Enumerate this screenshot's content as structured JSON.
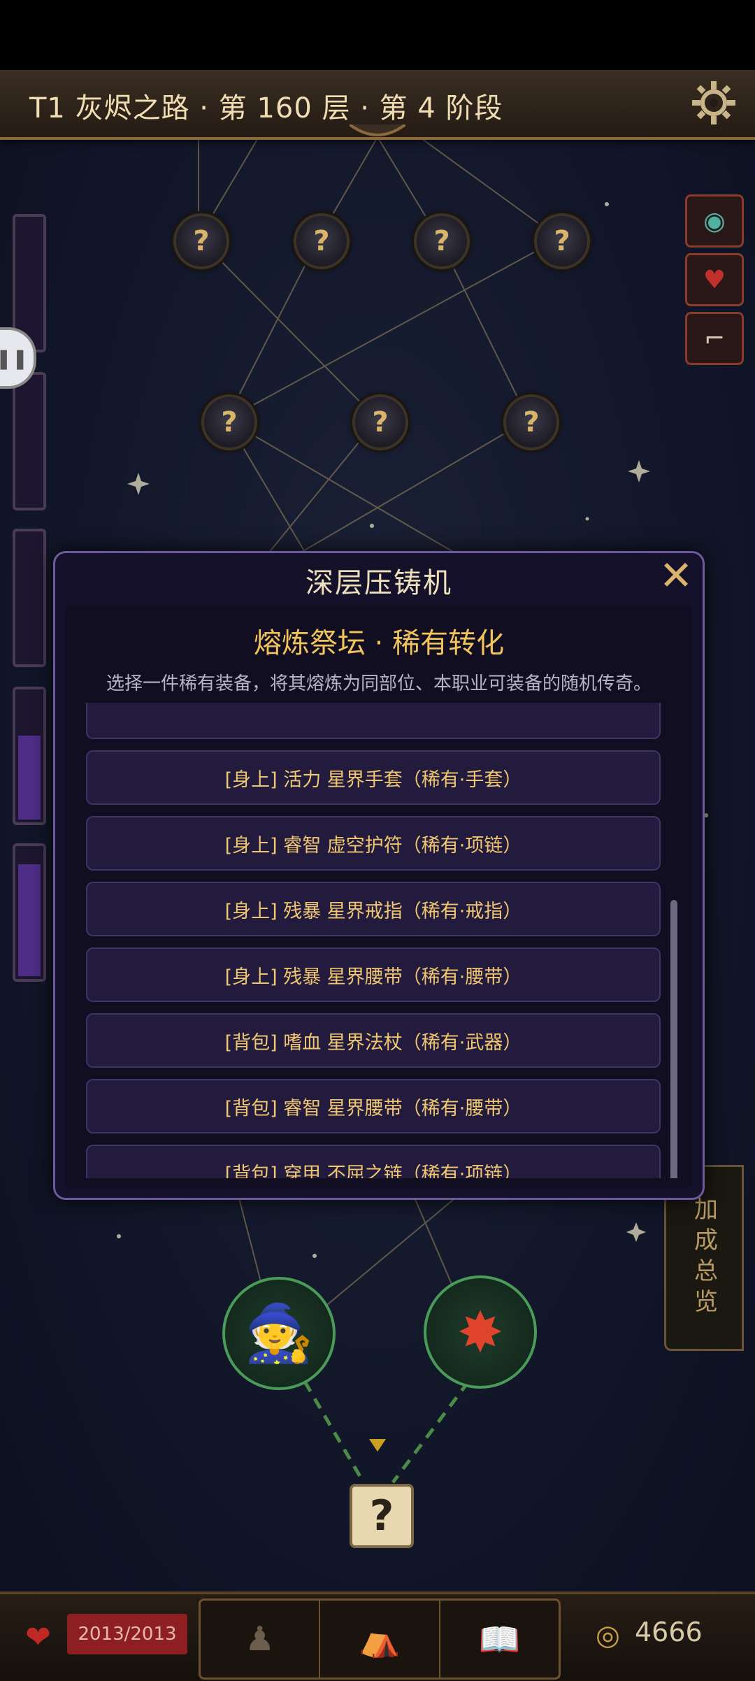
{
  "header": {
    "title": "T1 灰烬之路 · 第 160 层 · 第 4 阶段"
  },
  "map": {
    "node_glyph": "?",
    "event_nodes": [
      "merchant-icon",
      "battle-icon"
    ],
    "scroll_glyph": "?",
    "summary_tab_label": "加成总览"
  },
  "modal": {
    "title": "深层压铸机",
    "close_glyph": "✕",
    "subtitle": "熔炼祭坛 · 稀有转化",
    "description": "选择一件稀有装备，将其熔炼为同部位、本职业可装备的随机传奇。",
    "items": [
      {
        "label": ""
      },
      {
        "label": "[身上] 活力 星界手套（稀有·手套）"
      },
      {
        "label": "[身上] 睿智 虚空护符（稀有·项链）"
      },
      {
        "label": "[身上] 残暴 星界戒指（稀有·戒指）"
      },
      {
        "label": "[身上] 残暴 星界腰带（稀有·腰带）"
      },
      {
        "label": "[背包] 嗜血 星界法杖（稀有·武器）"
      },
      {
        "label": "[背包] 睿智 星界腰带（稀有·腰带）"
      },
      {
        "label": "[背包] 穿甲 不屈之链（稀有·项链）"
      }
    ]
  },
  "bottom": {
    "hp": "2013/2013",
    "gold": "4666",
    "tabs": [
      "character-icon",
      "backpack-icon",
      "book-icon"
    ]
  },
  "colors": {
    "accent_gold": "#f1c35a",
    "modal_border": "#6c5a9c",
    "event_ring": "#4a9a58"
  }
}
